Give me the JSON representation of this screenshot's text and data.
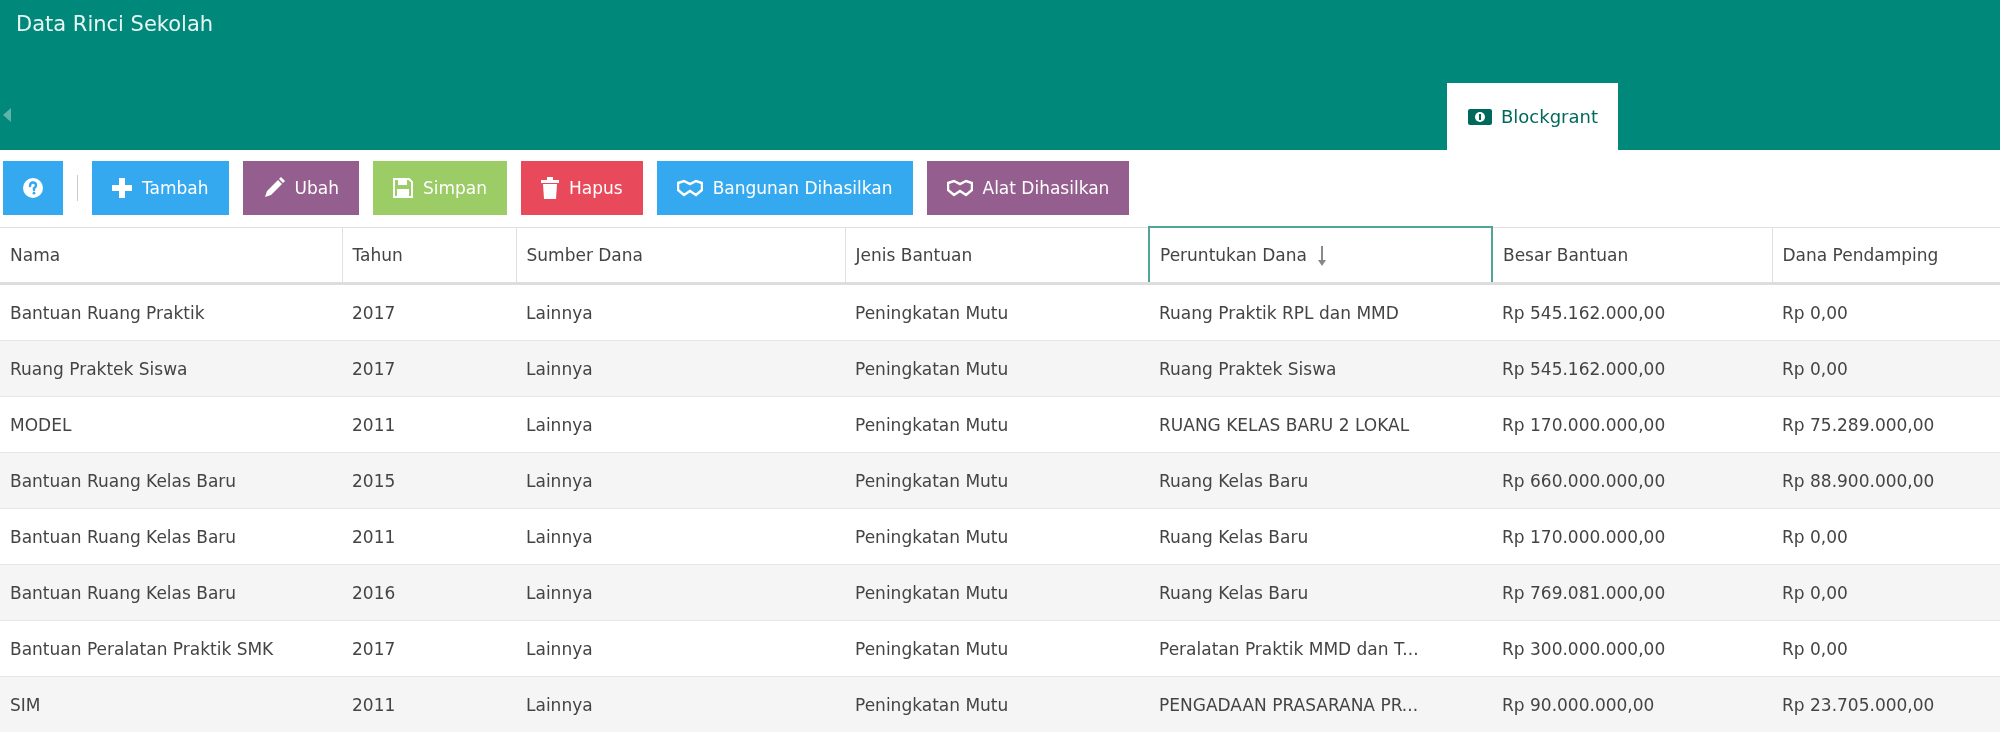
{
  "header": {
    "title": "Data Rinci Sekolah"
  },
  "tabs": [
    {
      "label": "Blockgrant",
      "selected": true
    }
  ],
  "toolbar": [
    {
      "kind": "help"
    },
    {
      "kind": "add",
      "label": "Tambah"
    },
    {
      "kind": "edit",
      "label": "Ubah"
    },
    {
      "kind": "save",
      "label": "Simpan"
    },
    {
      "kind": "delete",
      "label": "Hapus"
    },
    {
      "kind": "building",
      "label": "Bangunan Dihasilkan"
    },
    {
      "kind": "tool",
      "label": "Alat Dihasilkan"
    }
  ],
  "table": {
    "columns": [
      {
        "label": "Nama",
        "sorted": false
      },
      {
        "label": "Tahun",
        "sorted": false
      },
      {
        "label": "Sumber Dana",
        "sorted": false
      },
      {
        "label": "Jenis Bantuan",
        "sorted": false
      },
      {
        "label": "Peruntukan Dana",
        "sorted": true
      },
      {
        "label": "Besar Bantuan",
        "sorted": false
      },
      {
        "label": "Dana Pendamping",
        "sorted": false
      }
    ],
    "rows": [
      [
        "Bantuan Ruang Praktik",
        "2017",
        "Lainnya",
        "Peningkatan Mutu",
        "Ruang Praktik RPL dan MMD",
        "Rp 545.162.000,00",
        "Rp 0,00"
      ],
      [
        "Ruang Praktek Siswa",
        "2017",
        "Lainnya",
        "Peningkatan Mutu",
        "Ruang Praktek Siswa",
        "Rp 545.162.000,00",
        "Rp 0,00"
      ],
      [
        "MODEL",
        "2011",
        "Lainnya",
        "Peningkatan Mutu",
        "RUANG KELAS BARU 2 LOKAL",
        "Rp 170.000.000,00",
        "Rp 75.289.000,00"
      ],
      [
        "Bantuan Ruang Kelas Baru",
        "2015",
        "Lainnya",
        "Peningkatan Mutu",
        "Ruang Kelas Baru",
        "Rp 660.000.000,00",
        "Rp 88.900.000,00"
      ],
      [
        "Bantuan Ruang Kelas Baru",
        "2011",
        "Lainnya",
        "Peningkatan Mutu",
        "Ruang Kelas Baru",
        "Rp 170.000.000,00",
        "Rp 0,00"
      ],
      [
        "Bantuan Ruang Kelas Baru",
        "2016",
        "Lainnya",
        "Peningkatan Mutu",
        "Ruang Kelas Baru",
        "Rp 769.081.000,00",
        "Rp 0,00"
      ],
      [
        "Bantuan Peralatan Praktik SMK",
        "2017",
        "Lainnya",
        "Peningkatan Mutu",
        "Peralatan Praktik MMD dan T...",
        "Rp 300.000.000,00",
        "Rp 0,00"
      ],
      [
        "SIM",
        "2011",
        "Lainnya",
        "Peningkatan Mutu",
        "PENGADAAN PRASARANA PR...",
        "Rp 90.000.000,00",
        "Rp 23.705.000,00"
      ]
    ]
  }
}
